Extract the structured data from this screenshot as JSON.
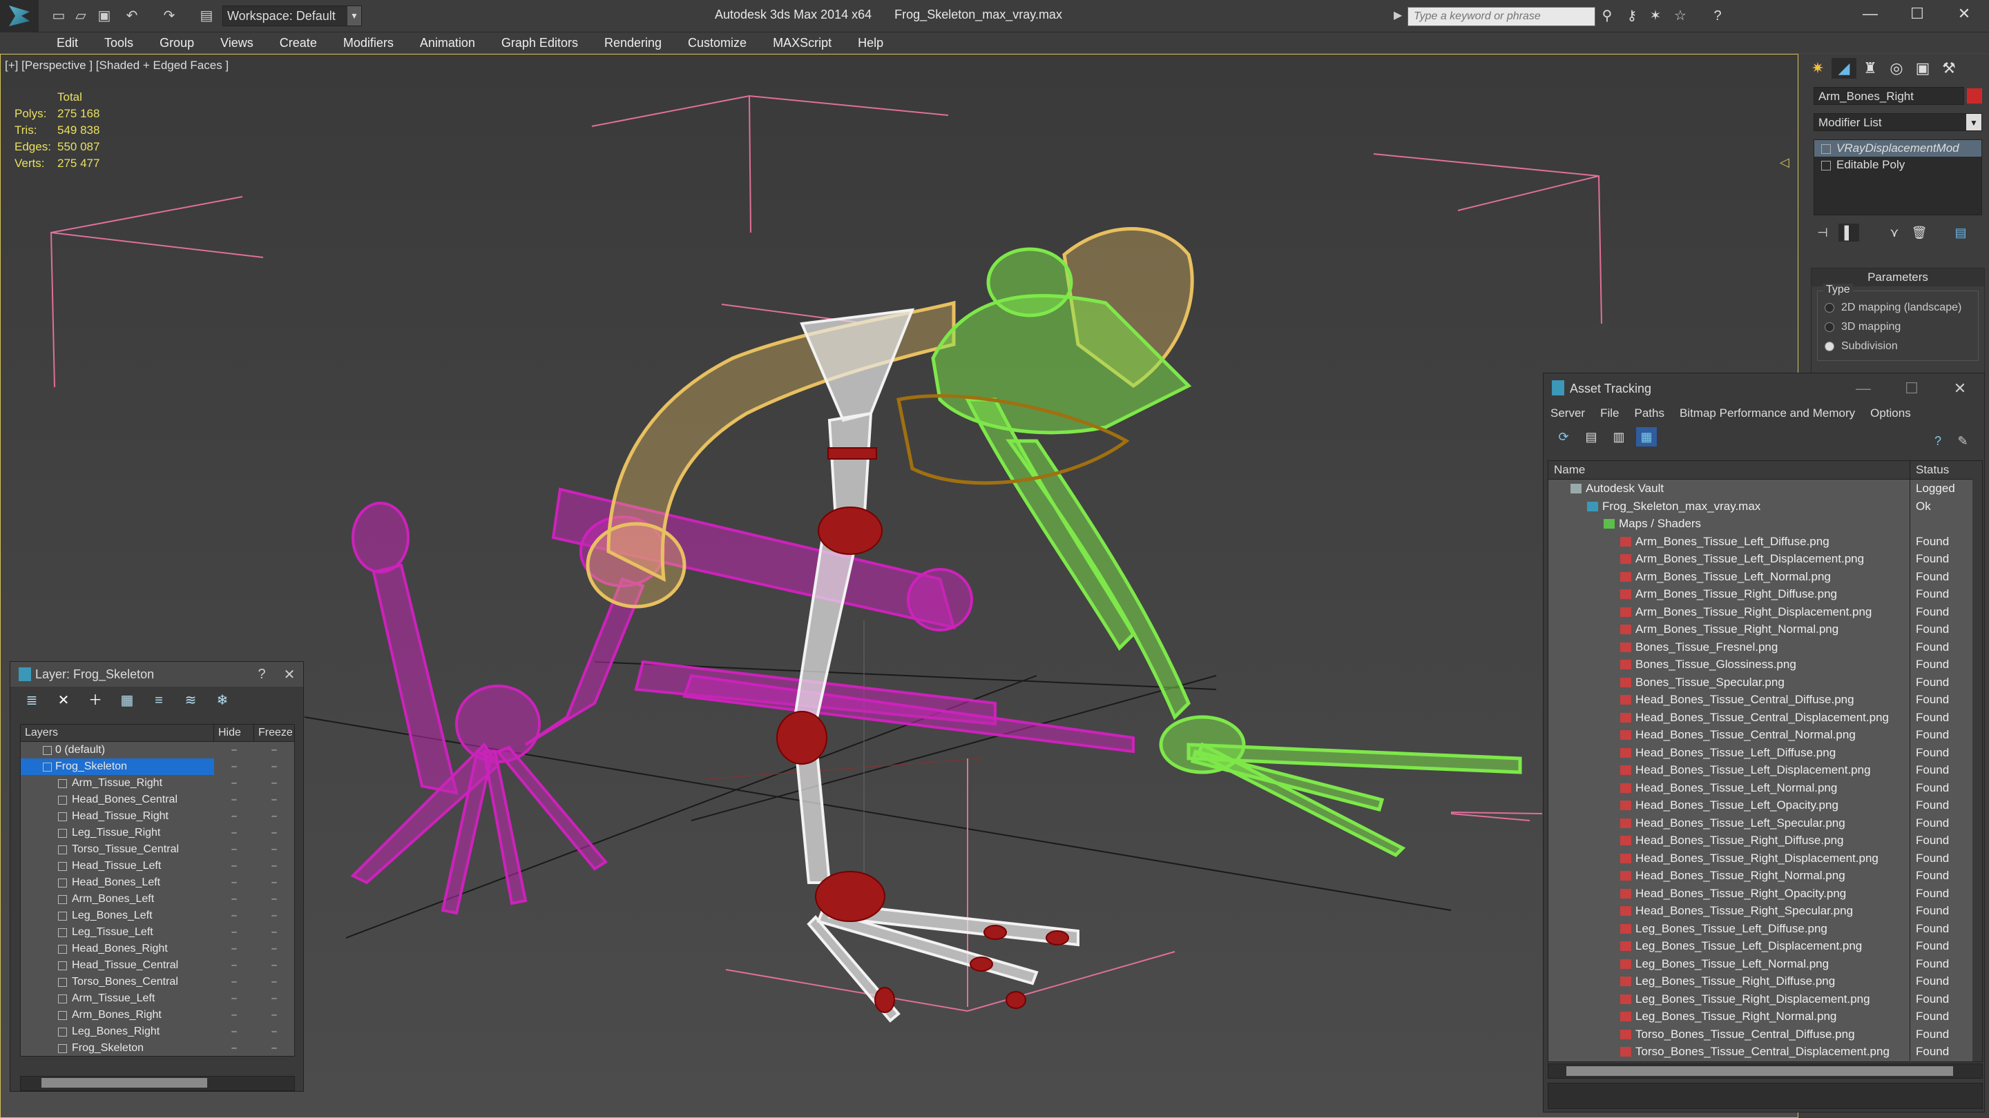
{
  "titlebar": {
    "workspace": "Workspace: Default",
    "app_title": "Autodesk 3ds Max  2014 x64",
    "file_name": "Frog_Skeleton_max_vray.max",
    "search_placeholder": "Type a keyword or phrase"
  },
  "menu": [
    "Edit",
    "Tools",
    "Group",
    "Views",
    "Create",
    "Modifiers",
    "Animation",
    "Graph Editors",
    "Rendering",
    "Customize",
    "MAXScript",
    "Help"
  ],
  "viewport": {
    "label": "[+] [Perspective ] [Shaded + Edged Faces ]",
    "stats_header": "Total",
    "stats": [
      {
        "k": "Polys:",
        "v": "275 168"
      },
      {
        "k": "Tris:",
        "v": "549 838"
      },
      {
        "k": "Edges:",
        "v": "550 087"
      },
      {
        "k": "Verts:",
        "v": "275 477"
      }
    ]
  },
  "command_panel": {
    "object_name": "Arm_Bones_Right",
    "object_color": "#cc2a2a",
    "modifier_list": "Modifier List",
    "stack": [
      "VRayDisplacementMod",
      "Editable Poly"
    ],
    "params_title": "Parameters",
    "type_label": "Type",
    "type_options": [
      "2D mapping (landscape)",
      "3D mapping",
      "Subdivision"
    ],
    "type_selected": "Subdivision"
  },
  "layer_window": {
    "title": "Layer: Frog_Skeleton",
    "help": "?",
    "close": "✕",
    "col_layers": "Layers",
    "col_hide": "Hide",
    "col_freeze": "Freeze",
    "rows": [
      {
        "name": "0 (default)",
        "level": "top"
      },
      {
        "name": "Frog_Skeleton",
        "level": "top",
        "selected": true
      },
      {
        "name": "Arm_Tissue_Right",
        "level": "child"
      },
      {
        "name": "Head_Bones_Central",
        "level": "child"
      },
      {
        "name": "Head_Tissue_Right",
        "level": "child"
      },
      {
        "name": "Leg_Tissue_Right",
        "level": "child"
      },
      {
        "name": "Torso_Tissue_Central",
        "level": "child"
      },
      {
        "name": "Head_Tissue_Left",
        "level": "child"
      },
      {
        "name": "Head_Bones_Left",
        "level": "child"
      },
      {
        "name": "Arm_Bones_Left",
        "level": "child"
      },
      {
        "name": "Leg_Bones_Left",
        "level": "child"
      },
      {
        "name": "Leg_Tissue_Left",
        "level": "child"
      },
      {
        "name": "Head_Bones_Right",
        "level": "child"
      },
      {
        "name": "Head_Tissue_Central",
        "level": "child"
      },
      {
        "name": "Torso_Bones_Central",
        "level": "child"
      },
      {
        "name": "Arm_Tissue_Left",
        "level": "child"
      },
      {
        "name": "Arm_Bones_Right",
        "level": "child"
      },
      {
        "name": "Leg_Bones_Right",
        "level": "child"
      },
      {
        "name": "Frog_Skeleton",
        "level": "child"
      }
    ]
  },
  "asset_window": {
    "title": "Asset Tracking",
    "menu": [
      "Server",
      "File",
      "Paths",
      "Bitmap Performance and Memory",
      "Options"
    ],
    "col_name": "Name",
    "col_status": "Status",
    "rows": [
      {
        "name": "Autodesk Vault",
        "status": "Logged",
        "indent": 1,
        "kind": "vault"
      },
      {
        "name": "Frog_Skeleton_max_vray.max",
        "status": "Ok",
        "indent": 2,
        "kind": "max"
      },
      {
        "name": "Maps / Shaders",
        "status": "",
        "indent": 3,
        "kind": "folder"
      },
      {
        "name": "Arm_Bones_Tissue_Left_Diffuse.png",
        "status": "Found",
        "indent": 4,
        "kind": "png"
      },
      {
        "name": "Arm_Bones_Tissue_Left_Displacement.png",
        "status": "Found",
        "indent": 4,
        "kind": "png"
      },
      {
        "name": "Arm_Bones_Tissue_Left_Normal.png",
        "status": "Found",
        "indent": 4,
        "kind": "png"
      },
      {
        "name": "Arm_Bones_Tissue_Right_Diffuse.png",
        "status": "Found",
        "indent": 4,
        "kind": "png"
      },
      {
        "name": "Arm_Bones_Tissue_Right_Displacement.png",
        "status": "Found",
        "indent": 4,
        "kind": "png"
      },
      {
        "name": "Arm_Bones_Tissue_Right_Normal.png",
        "status": "Found",
        "indent": 4,
        "kind": "png"
      },
      {
        "name": "Bones_Tissue_Fresnel.png",
        "status": "Found",
        "indent": 4,
        "kind": "png"
      },
      {
        "name": "Bones_Tissue_Glossiness.png",
        "status": "Found",
        "indent": 4,
        "kind": "png"
      },
      {
        "name": "Bones_Tissue_Specular.png",
        "status": "Found",
        "indent": 4,
        "kind": "png"
      },
      {
        "name": "Head_Bones_Tissue_Central_Diffuse.png",
        "status": "Found",
        "indent": 4,
        "kind": "png"
      },
      {
        "name": "Head_Bones_Tissue_Central_Displacement.png",
        "status": "Found",
        "indent": 4,
        "kind": "png"
      },
      {
        "name": "Head_Bones_Tissue_Central_Normal.png",
        "status": "Found",
        "indent": 4,
        "kind": "png"
      },
      {
        "name": "Head_Bones_Tissue_Left_Diffuse.png",
        "status": "Found",
        "indent": 4,
        "kind": "png"
      },
      {
        "name": "Head_Bones_Tissue_Left_Displacement.png",
        "status": "Found",
        "indent": 4,
        "kind": "png"
      },
      {
        "name": "Head_Bones_Tissue_Left_Normal.png",
        "status": "Found",
        "indent": 4,
        "kind": "png"
      },
      {
        "name": "Head_Bones_Tissue_Left_Opacity.png",
        "status": "Found",
        "indent": 4,
        "kind": "png"
      },
      {
        "name": "Head_Bones_Tissue_Left_Specular.png",
        "status": "Found",
        "indent": 4,
        "kind": "png"
      },
      {
        "name": "Head_Bones_Tissue_Right_Diffuse.png",
        "status": "Found",
        "indent": 4,
        "kind": "png"
      },
      {
        "name": "Head_Bones_Tissue_Right_Displacement.png",
        "status": "Found",
        "indent": 4,
        "kind": "png"
      },
      {
        "name": "Head_Bones_Tissue_Right_Normal.png",
        "status": "Found",
        "indent": 4,
        "kind": "png"
      },
      {
        "name": "Head_Bones_Tissue_Right_Opacity.png",
        "status": "Found",
        "indent": 4,
        "kind": "png"
      },
      {
        "name": "Head_Bones_Tissue_Right_Specular.png",
        "status": "Found",
        "indent": 4,
        "kind": "png"
      },
      {
        "name": "Leg_Bones_Tissue_Left_Diffuse.png",
        "status": "Found",
        "indent": 4,
        "kind": "png"
      },
      {
        "name": "Leg_Bones_Tissue_Left_Displacement.png",
        "status": "Found",
        "indent": 4,
        "kind": "png"
      },
      {
        "name": "Leg_Bones_Tissue_Left_Normal.png",
        "status": "Found",
        "indent": 4,
        "kind": "png"
      },
      {
        "name": "Leg_Bones_Tissue_Right_Diffuse.png",
        "status": "Found",
        "indent": 4,
        "kind": "png"
      },
      {
        "name": "Leg_Bones_Tissue_Right_Displacement.png",
        "status": "Found",
        "indent": 4,
        "kind": "png"
      },
      {
        "name": "Leg_Bones_Tissue_Right_Normal.png",
        "status": "Found",
        "indent": 4,
        "kind": "png"
      },
      {
        "name": "Torso_Bones_Tissue_Central_Diffuse.png",
        "status": "Found",
        "indent": 4,
        "kind": "png"
      },
      {
        "name": "Torso_Bones_Tissue_Central_Displacement.png",
        "status": "Found",
        "indent": 4,
        "kind": "png"
      }
    ]
  },
  "colors": {
    "viewport_border": "#d6c25a",
    "stats_text": "#e8e060",
    "selection_blue": "#1d6fd1",
    "bone_magenta": "#cc22bb",
    "bone_green": "#7ee84a",
    "bone_yellow": "#e8c060",
    "bone_red": "#a01818"
  }
}
